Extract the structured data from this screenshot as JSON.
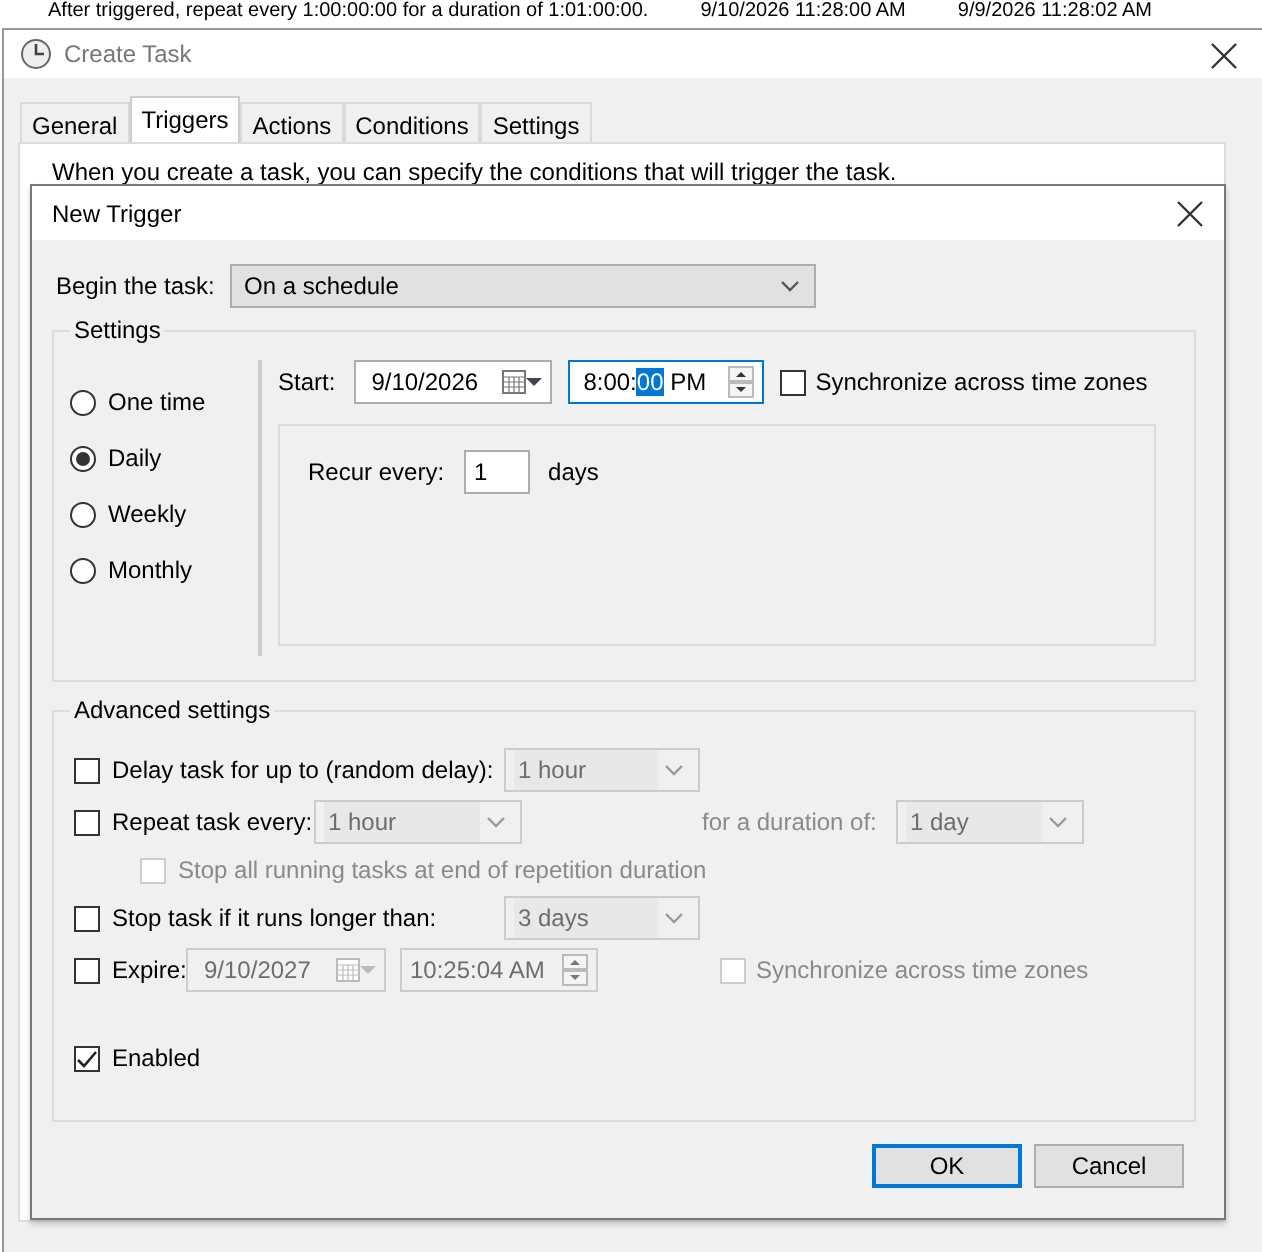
{
  "background_row": {
    "text": "After triggered, repeat every 1:00:00:00 for a duration of 1:01:00:00.",
    "column_2": "9/10/2026 11:28:00 AM",
    "column_3": "9/9/2026 11:28:02 AM"
  },
  "window": {
    "title": "Create Task"
  },
  "tabs": [
    {
      "label": "General",
      "selected": false
    },
    {
      "label": "Triggers",
      "selected": true
    },
    {
      "label": "Actions",
      "selected": false
    },
    {
      "label": "Conditions",
      "selected": false
    },
    {
      "label": "Settings",
      "selected": false
    }
  ],
  "tab_panel": {
    "description": "When you create a task, you can specify the conditions that will trigger the task."
  },
  "dialog": {
    "title": "New Trigger",
    "begin_label": "Begin the task:",
    "begin_value": "On a schedule",
    "settings": {
      "legend": "Settings",
      "schedules": [
        {
          "label": "One time",
          "selected": false
        },
        {
          "label": "Daily",
          "selected": true
        },
        {
          "label": "Weekly",
          "selected": false
        },
        {
          "label": "Monthly",
          "selected": false
        }
      ],
      "start_label": "Start:",
      "start_date": "9/10/2026",
      "start_time": {
        "before": "8:00:",
        "highlighted": "00",
        "after": " PM"
      },
      "sync": {
        "label": "Synchronize across time zones",
        "checked": false
      },
      "recur_label": "Recur every:",
      "recur_value": "1",
      "recur_unit": "days"
    },
    "advanced": {
      "legend": "Advanced settings",
      "rows": [
        {
          "kind": "select",
          "label": "Delay task for up to (random delay):",
          "checked": false,
          "value": "1 hour"
        },
        {
          "kind": "repeat",
          "label": "Repeat task every:",
          "checked": false,
          "value": "1 hour",
          "duration_label": "for a duration of:",
          "duration_value": "1 day"
        },
        {
          "kind": "sub",
          "label": "Stop all running tasks at end of repetition duration",
          "checked": false,
          "disabled": true
        },
        {
          "kind": "select",
          "label": "Stop task if it runs longer than:",
          "checked": false,
          "value": "3 days"
        },
        {
          "kind": "expire",
          "label": "Expire:",
          "checked": false,
          "date": "9/10/2027",
          "time": "10:25:04 AM",
          "sync_label": "Synchronize across time zones",
          "sync_checked": false
        },
        {
          "kind": "gap"
        },
        {
          "kind": "check",
          "label": "Enabled",
          "checked": true
        }
      ]
    },
    "buttons": [
      {
        "label": "OK",
        "default": true
      },
      {
        "label": "Cancel",
        "default": false
      }
    ]
  }
}
